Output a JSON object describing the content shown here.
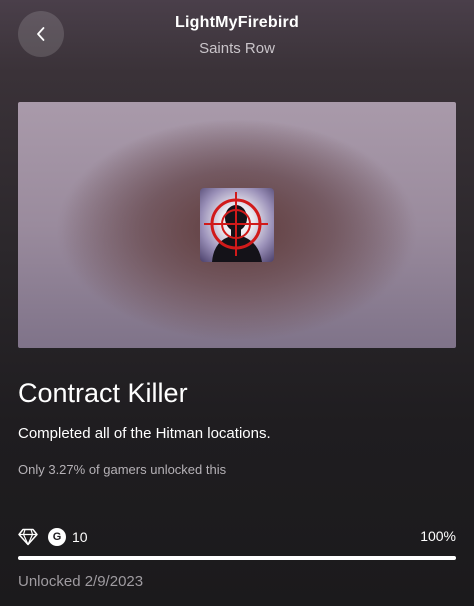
{
  "header": {
    "title": "LightMyFirebird",
    "subtitle": "Saints Row",
    "back_icon": "chevron-left-icon"
  },
  "hero": {
    "icon": "crosshair-silhouette-icon"
  },
  "achievement": {
    "title": "Contract Killer",
    "description": "Completed all of the Hitman locations.",
    "rarity": "Only 3.27% of gamers unlocked this",
    "reward_icon": "diamond-icon",
    "gamerscore_badge": "G",
    "gamerscore": "10",
    "progress_text": "100%",
    "progress_fraction": 1.0,
    "unlocked": "Unlocked 2/9/2023"
  },
  "colors": {
    "progress_fill": "#ffffff",
    "progress_track": "#4a474b",
    "crosshair": "#d11a1a"
  }
}
